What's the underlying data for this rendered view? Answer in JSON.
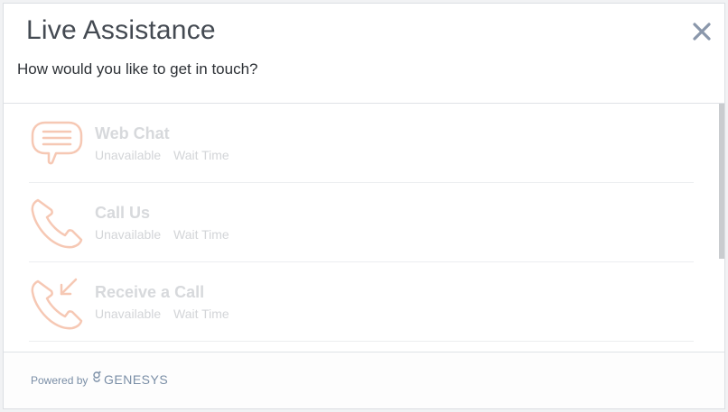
{
  "dialog": {
    "title": "Live Assistance",
    "subtitle": "How would you like to get in touch?",
    "close_icon": "close-icon"
  },
  "options": [
    {
      "icon": "chat-bubble-icon",
      "title": "Web Chat",
      "status": "Unavailable",
      "wait": "Wait Time"
    },
    {
      "icon": "phone-icon",
      "title": "Call Us",
      "status": "Unavailable",
      "wait": "Wait Time"
    },
    {
      "icon": "phone-incoming-icon",
      "title": "Receive a Call",
      "status": "Unavailable",
      "wait": "Wait Time"
    }
  ],
  "footer": {
    "powered_by": "Powered by",
    "brand": "GENESYS",
    "brand_icon": "genesys-logo-icon"
  },
  "colors": {
    "accent_icon": "#f6c8b4",
    "muted_text": "#d3d5d8",
    "brand": "#7a8ea6"
  }
}
